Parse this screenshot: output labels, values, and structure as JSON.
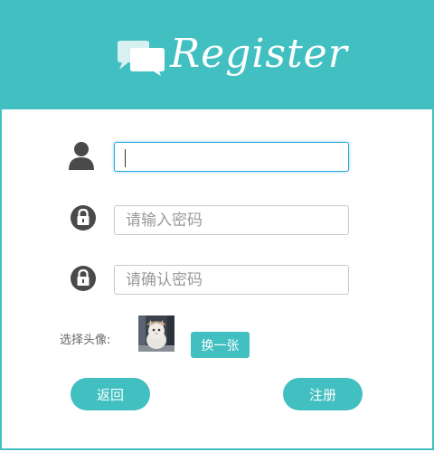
{
  "header": {
    "title": "Register",
    "logo_icon": "chat-bubbles-icon",
    "background": "#41bfc1"
  },
  "form": {
    "username": {
      "value": "",
      "placeholder": "",
      "icon": "user-icon"
    },
    "password": {
      "value": "",
      "placeholder": "请输入密码",
      "icon": "lock-icon"
    },
    "confirm_password": {
      "value": "",
      "placeholder": "请确认密码",
      "icon": "lock-icon"
    },
    "avatar": {
      "label": "选择头像:",
      "swap_label": "换一张"
    }
  },
  "actions": {
    "back_label": "返回",
    "register_label": "注册"
  },
  "colors": {
    "accent": "#41bfc1",
    "focus_border": "#2ea7e0",
    "icon": "#4a4a4a"
  }
}
